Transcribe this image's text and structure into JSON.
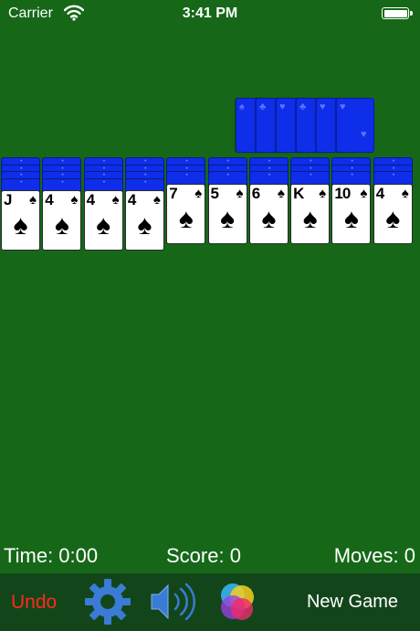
{
  "status_bar": {
    "carrier": "Carrier",
    "time": "3:41 PM"
  },
  "stock": {
    "face_down_cards": 6,
    "back_pips": [
      "♠",
      "♣",
      "♥",
      "♣",
      "♥",
      "♥"
    ]
  },
  "tableau": {
    "columns": [
      {
        "face_down": 4,
        "rank": "J",
        "suit": "♠"
      },
      {
        "face_down": 4,
        "rank": "4",
        "suit": "♠"
      },
      {
        "face_down": 4,
        "rank": "4",
        "suit": "♠"
      },
      {
        "face_down": 4,
        "rank": "4",
        "suit": "♠"
      },
      {
        "face_down": 3,
        "rank": "7",
        "suit": "♠"
      },
      {
        "face_down": 3,
        "rank": "5",
        "suit": "♠"
      },
      {
        "face_down": 3,
        "rank": "6",
        "suit": "♠"
      },
      {
        "face_down": 3,
        "rank": "K",
        "suit": "♠"
      },
      {
        "face_down": 3,
        "rank": "10",
        "suit": "♠"
      },
      {
        "face_down": 3,
        "rank": "4",
        "suit": "♠"
      }
    ]
  },
  "stats": {
    "time": "Time: 0:00",
    "score": "Score: 0",
    "moves": "Moves: 0"
  },
  "toolbar": {
    "undo_label": "Undo",
    "new_game_label": "New Game",
    "undo_color": "#ff2a1a",
    "settings_icon": "gear-icon",
    "sound_icon": "speaker-icon",
    "theme_icon": "color-circles-icon"
  },
  "colors": {
    "felt": "#166818",
    "toolbar": "#12461a",
    "card_back": "#0f2eea",
    "gear": "#3a7bd5"
  }
}
